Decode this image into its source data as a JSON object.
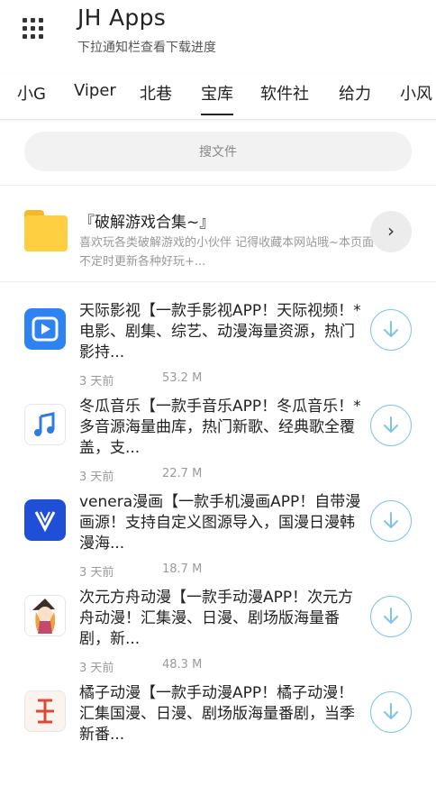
{
  "header": {
    "title": "JH Apps",
    "subtitle": "下拉通知栏查看下载进度",
    "icon": "grid-icon"
  },
  "tabs": [
    {
      "label": "小G"
    },
    {
      "label": "Viper"
    },
    {
      "label": "北巷"
    },
    {
      "label": "宝库",
      "active": true
    },
    {
      "label": "软件社"
    },
    {
      "label": "给力"
    },
    {
      "label": "小风"
    }
  ],
  "search": {
    "placeholder": "搜文件"
  },
  "folder": {
    "title": "『破解游戏合集~』",
    "description": "喜欢玩各类破解游戏的小伙伴 记得收藏本网站哦~本页面不定时更新各种好玩+...",
    "icon": "folder-icon",
    "arrow_icon": "chevron-right-icon"
  },
  "files": [
    {
      "title": "天际影视【一款手影视APP！天际视频！*电影、剧集、综艺、动漫海量资源，热门影持...",
      "age": "3 天前",
      "size": "53.2 M",
      "icon": "play-icon",
      "icon_color": "#2e83f2"
    },
    {
      "title": "冬瓜音乐【一款手音乐APP！冬瓜音乐！*多音源海量曲库，热门新歌、经典歌全覆盖，支...",
      "age": "3 天前",
      "size": "22.7 M",
      "icon": "music-note-icon",
      "icon_color": "#2d7be6"
    },
    {
      "title": "venera漫画【一款手机漫画APP！自带漫画源！支持自定义图源导入，国漫日漫韩漫海...",
      "age": "3 天前",
      "size": "18.7 M",
      "icon": "venera-logo-icon",
      "icon_color": "#1f4fd6"
    },
    {
      "title": "次元方舟动漫【一款手动漫APP！次元方舟动漫！汇集漫、日漫、剧场版海量番剧，新...",
      "age": "3 天前",
      "size": "48.3 M",
      "icon": "anime-girl-icon",
      "icon_color": "#f0a040"
    },
    {
      "title": "橘子动漫【一款手动漫APP！橘子动漫！汇集国漫、日漫、剧场版海量番剧，当季新番...",
      "age": "",
      "size": "",
      "icon": "orange-character-icon",
      "icon_color": "#d84a3a"
    }
  ],
  "colors": {
    "accent": "#7ec4e8",
    "folder": "#ffcf42"
  }
}
